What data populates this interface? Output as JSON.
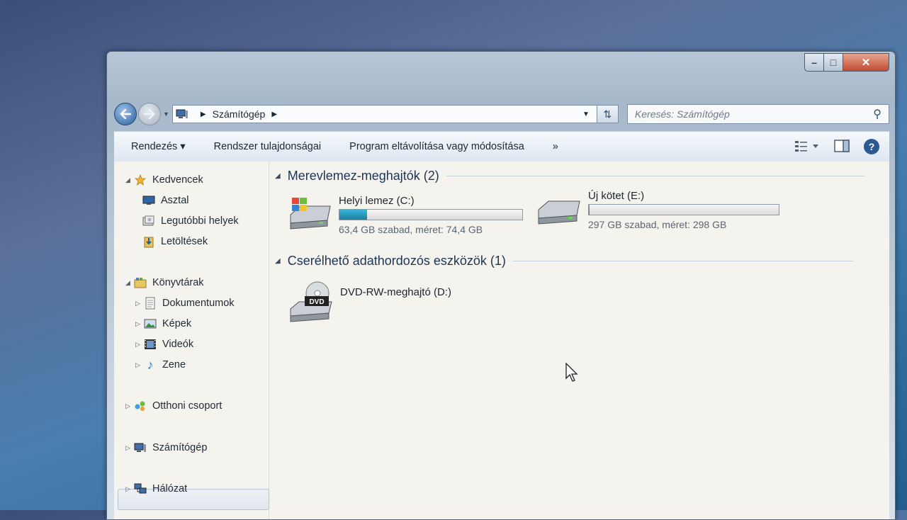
{
  "window": {
    "caption_buttons": {
      "minimize": "–",
      "maximize": "□",
      "close": "✕"
    }
  },
  "address": {
    "crumbs": [
      "Számítógép"
    ],
    "search_placeholder": "Keresés: Számítógép"
  },
  "toolbar": {
    "organize": "Rendezés ▾",
    "system_properties": "Rendszer tulajdonságai",
    "uninstall": "Program eltávolítása vagy módosítása",
    "more": "»",
    "help": "?"
  },
  "nav": {
    "favorites": {
      "label": "Kedvencek",
      "items": [
        "Asztal",
        "Legutóbbi helyek",
        "Letöltések"
      ]
    },
    "libraries": {
      "label": "Könyvtárak",
      "items": [
        "Dokumentumok",
        "Képek",
        "Videók",
        "Zene"
      ]
    },
    "homegroup": "Otthoni csoport",
    "computer": "Számítógép",
    "network": "Hálózat"
  },
  "groups": {
    "hdd": {
      "title": "Merevlemez-meghajtók (2)",
      "drives": [
        {
          "name": "Helyi lemez (C:)",
          "info": "63,4 GB szabad, méret: 74,4 GB",
          "used_fraction": 0.15
        },
        {
          "name": "Új kötet (E:)",
          "info": "297 GB szabad, méret: 298 GB",
          "used_fraction": 0.003
        }
      ]
    },
    "removable": {
      "title": "Cserélhető adathordozós eszközök (1)",
      "drives": [
        {
          "name": "DVD-RW-meghajtó (D:)",
          "badge": "DVD"
        }
      ]
    }
  },
  "icons": {
    "back": "back-arrow-icon",
    "forward": "forward-arrow-icon",
    "search": "magnifier-icon",
    "favorites": "star-icon",
    "desktop": "desktop-icon",
    "recent": "recent-places-icon",
    "downloads": "downloads-icon",
    "libraries": "libraries-icon",
    "documents": "document-icon",
    "pictures": "picture-icon",
    "videos": "film-icon",
    "music": "music-note-icon",
    "homegroup": "homegroup-icon",
    "computer": "computer-icon",
    "network": "network-icon"
  },
  "colors": {
    "accent": "#2c5d99",
    "usage_bar": "#2a9cc3",
    "close_button": "#c24a32"
  }
}
